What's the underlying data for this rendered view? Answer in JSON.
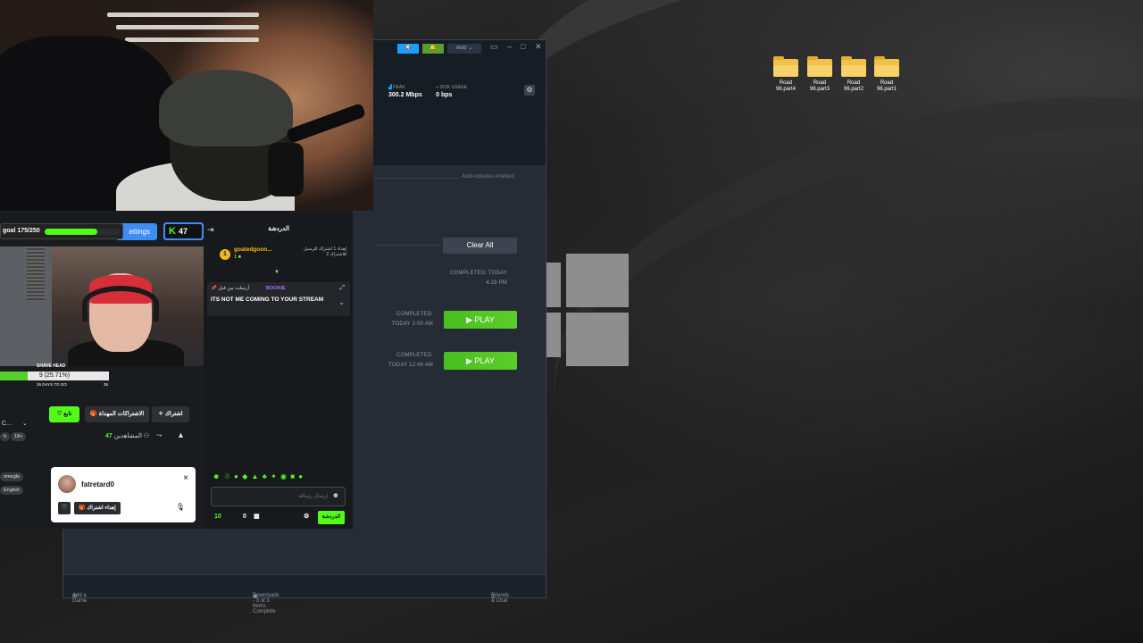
{
  "steam": {
    "topbar": {
      "user": "rexb ⌄"
    },
    "stats": {
      "peak_label": "PEAK",
      "peak_value": "300.2 Mbps",
      "disk_label": "DISK USAGE",
      "disk_value": "0 bps"
    },
    "auto_updates": "Auto-updates enabled",
    "clear_all": "Clear All",
    "downloads": [
      {
        "status_line1": "COMPLETED: TODAY",
        "status_line2": "4:28 PM",
        "play": ""
      },
      {
        "status_line1": "COMPLETED:",
        "status_line2": "TODAY 2:00 AM",
        "play": "PLAY"
      },
      {
        "status_line1": "COMPLETED:",
        "status_line2": "TODAY 12:49 AM",
        "play": "PLAY"
      }
    ],
    "bottom": {
      "add_game": "Add a Game",
      "downloads_status": "Downloads - 3 of 3 Items Complete",
      "friends": "Friends & Chat"
    }
  },
  "desktop_icons": [
    {
      "line1": "Road",
      "line2": "96.part4"
    },
    {
      "line1": "Road",
      "line2": "96.part3"
    },
    {
      "line1": "Road",
      "line2": "96.part2"
    },
    {
      "line1": "Road",
      "line2": "96.part1"
    }
  ],
  "kick": {
    "goal": "goal 175/250",
    "goal_progress": 0.7,
    "settings": "ettings",
    "k_count": "47",
    "shave_label": "SHAVE HEAD",
    "shave_progress": "9 (25.71%)",
    "shave_fraction": 0.2571,
    "days_to_go": "26 DAYS TO GO",
    "days_total": "35",
    "follow": "♡ تابع",
    "gift_subs": "🎁 الاشتراكات المهداة",
    "subscribe": "✧ اشتراك",
    "viewers_label": "المشاهدين",
    "viewers_count": "47",
    "tag_c": "C...",
    "tag_h": "h",
    "tag_18": "18+",
    "tag_omegle": "omegle",
    "tag_english": "English",
    "popup": {
      "name": "fatretard0",
      "gift": "🎁 إهداء اشتراك",
      "heart": "♡",
      "close": "×"
    },
    "chat": {
      "title": "الدردشة",
      "pinned_name": "goatedgoon...",
      "pinned_count": "1",
      "pinned_badge": "1",
      "pinned_info": "إهداء 1 اشتراك للرسيل للاشتراك 2",
      "msg_meta": "أرسلت من قبل",
      "msg_user": "BOOKIE",
      "msg_text": "ITS NOT ME COMING TO YOUR STREAM",
      "emotes": "☻ ☃ ● ◆ ▲ ♣ ✦ ◉ ■ ●",
      "input_placeholder": "إرسال رسالة",
      "points": "10",
      "zero": "0",
      "send": "الدردشة"
    }
  }
}
